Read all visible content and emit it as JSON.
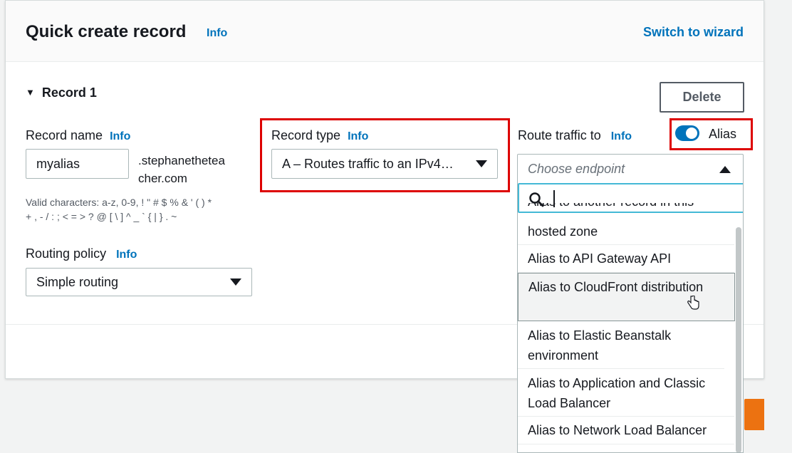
{
  "header": {
    "title": "Quick create record",
    "info": "Info",
    "switch_label": "Switch to wizard"
  },
  "record": {
    "title": "Record 1",
    "delete_label": "Delete"
  },
  "record_name": {
    "label": "Record name",
    "info": "Info",
    "value": "myalias",
    "domain_suffix_1": ".stephanetheteа",
    "domain_suffix_2": "cher.com",
    "hint_1": "Valid characters: a-z, 0-9, ! \" # $ % & ' ( ) *",
    "hint_2": "+ , - / : ; < = > ? @ [ \\ ] ^ _ ` { | } . ~"
  },
  "record_type": {
    "label": "Record type",
    "info": "Info",
    "value": "A – Routes traffic to an IPv4…"
  },
  "route_traffic": {
    "label": "Route traffic to",
    "info": "Info",
    "alias_label": "Alias",
    "alias_on": true,
    "endpoint_placeholder": "Choose endpoint"
  },
  "routing_policy": {
    "label": "Routing policy",
    "info": "Info",
    "value": "Simple routing"
  },
  "dropdown": {
    "partial_option_top": "Alias to another record in this",
    "options": [
      "hosted zone",
      "Alias to API Gateway API",
      "Alias to CloudFront distribution",
      "Alias to Elastic Beanstalk environment",
      "Alias to Application and Classic Load Balancer",
      "Alias to Network Load Balancer"
    ]
  },
  "colors": {
    "accent": "#0073bb",
    "highlight": "#dd0000",
    "primary_button": "#ec7211"
  }
}
